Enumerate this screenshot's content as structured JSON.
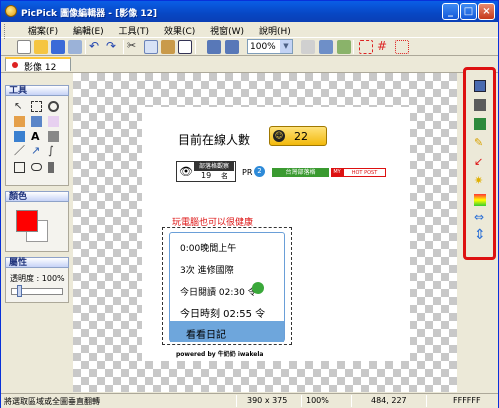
{
  "window": {
    "title": "PicPick 圖像編輯器 - [影像 12]"
  },
  "menu": [
    "檔案(F)",
    "編輯(E)",
    "工具(T)",
    "效果(C)",
    "視窗(W)",
    "說明(H)"
  ],
  "toolbar": {
    "zoom": "100%"
  },
  "tab": {
    "label": "影像 12"
  },
  "panels": {
    "tools_title": "工具",
    "color_title": "顏色",
    "props_title": "屬性",
    "opacity_label": "透明度 : 100%"
  },
  "image": {
    "online_label": "目前在線人數",
    "online_count": "22",
    "badge_label": "部落格觀察",
    "badge_rank": "19",
    "badge_unit": "名",
    "pr_label": "PR",
    "pr_value": "2",
    "green_badge": "台灣部落格",
    "hot_badge_left": "MY",
    "hot_badge_right": "HOT POST",
    "headline": "玩電腦也可以很健康",
    "list_items": [
      "0:00晚間上午",
      "3次 進修國際",
      "今日閱讀 02:30 令",
      "今日時刻 02:55 令"
    ],
    "list_selected": "看看日記",
    "credit": "powered by 牛奶奶 iwakela"
  },
  "status": {
    "hint": "將選取區域或全圖垂直翻轉",
    "size": "390 x 375",
    "zoom": "100%",
    "coords": "484, 227",
    "color": "FFFFFF"
  },
  "colors": {
    "fg": "#ff0000",
    "bg": "#ffffff",
    "highlight": "#d11111"
  }
}
